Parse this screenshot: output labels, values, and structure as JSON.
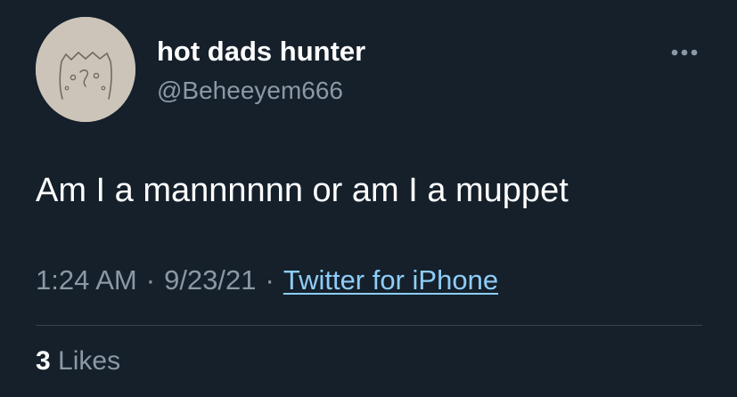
{
  "author": {
    "display_name": "hot dads hunter",
    "handle": "@Beheeyem666",
    "avatar_icon": "doodle-face-avatar"
  },
  "more_icon": "more-options-icon",
  "tweet": {
    "text": "Am I a mannnnnn or am I a muppet"
  },
  "meta": {
    "time": "1:24 AM",
    "separator": "·",
    "date": "9/23/21",
    "source": "Twitter for iPhone"
  },
  "stats": {
    "likes_count": "3",
    "likes_label": "Likes"
  },
  "colors": {
    "background": "#15202b",
    "primary_text": "#ffffff",
    "secondary_text": "#8b98a5",
    "link": "#8ecdf8",
    "divider": "#38444d"
  }
}
